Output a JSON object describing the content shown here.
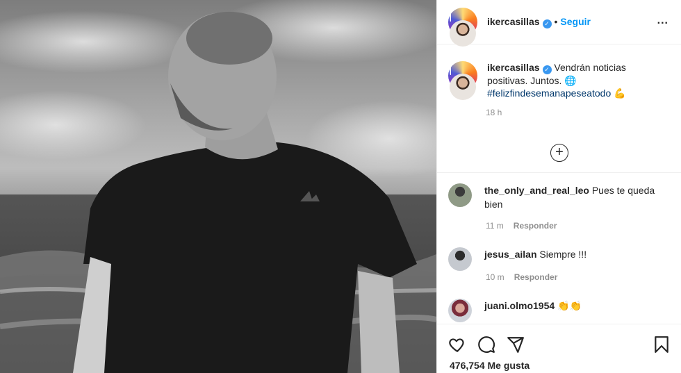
{
  "header": {
    "username": "ikercasillas",
    "separator": "•",
    "follow_label": "Seguir",
    "more_label": "..."
  },
  "caption": {
    "username": "ikercasillas",
    "text": "Vendrán noticias positivas. Juntos. 🌐",
    "hashtag": "#felizfindesemanapeseatodo 💪",
    "time": "18 h"
  },
  "load_more_label": "+",
  "comments": [
    {
      "username": "the_only_and_real_leo",
      "text": "Pues te queda bien",
      "time": "11 m",
      "reply_label": "Responder"
    },
    {
      "username": "jesus_ailan",
      "text": "Siempre !!!",
      "time": "10 m",
      "reply_label": "Responder"
    },
    {
      "username": "juani.olmo1954",
      "text": "👏👏"
    }
  ],
  "likes": {
    "text": "476,754 Me gusta"
  },
  "icons": [
    "heart-icon",
    "comment-icon",
    "share-icon",
    "bookmark-icon",
    "verified-icon",
    "add-circle-icon",
    "more-icon"
  ],
  "colors": {
    "link": "#0095f6",
    "verified": "#3897f0",
    "hashtag": "#00376b",
    "muted": "#8e8e8e"
  }
}
